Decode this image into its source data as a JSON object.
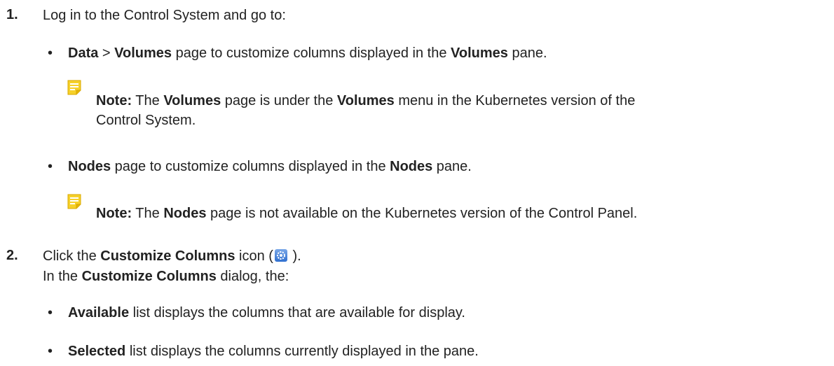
{
  "step1": {
    "number": "1.",
    "text": "Log in to the Control System and go to:",
    "bullets": [
      {
        "b1": "Data",
        "sep": " > ",
        "b2": "Volumes",
        "t1": " page to customize columns displayed in the ",
        "b3": "Volumes",
        "t2": " pane.",
        "note": {
          "label": "Note:",
          "t1": " The ",
          "b1": "Volumes",
          "t2": " page is under the ",
          "b2": "Volumes",
          "t3": " menu in the Kubernetes version of the",
          "line2": "Control System."
        }
      },
      {
        "b1": "Nodes",
        "t1": " page to customize columns displayed in the ",
        "b2": "Nodes",
        "t2": " pane.",
        "note": {
          "label": "Note:",
          "t1": " The ",
          "b1": "Nodes",
          "t2": " page is not available on the Kubernetes version of the Control Panel."
        }
      }
    ]
  },
  "step2": {
    "number": "2.",
    "t1": "Click the ",
    "b1": "Customize Columns",
    "t2": " icon (",
    "t3": " ).",
    "line2_t1": "In the ",
    "line2_b1": "Customize Columns",
    "line2_t2": " dialog, the:",
    "bullets": [
      {
        "b1": "Available",
        "t1": " list displays the columns that are available for display."
      },
      {
        "b1": "Selected",
        "t1": " list displays the columns currently displayed in the pane."
      }
    ]
  },
  "icons": {
    "note": "note-icon",
    "customize": "gear-icon"
  },
  "colors": {
    "note_icon": "#f2c81b",
    "gear_icon": "#3b7bd8"
  }
}
